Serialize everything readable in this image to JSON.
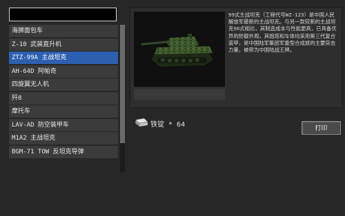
{
  "search": {
    "value": ""
  },
  "items": [
    {
      "label": "海狮面包车"
    },
    {
      "label": "Z-10 武装直升机"
    },
    {
      "label": "ZTZ-99A 主战坦克"
    },
    {
      "label": "AH-64D 阿帕奇"
    },
    {
      "label": "四旋翼无人机"
    },
    {
      "label": "歼8"
    },
    {
      "label": "摩托车"
    },
    {
      "label": "LAV-AD 防空装甲车"
    },
    {
      "label": "M1A2 主战坦克"
    },
    {
      "label": "BGM-71 TOW 反坦克导弹"
    }
  ],
  "selected_index": 2,
  "detail": {
    "description": "99式主战坦克（工程代号WZ-123）是中国人民解放军最新的主战坦克。与另一款较新的主战坦克96式相比，其制造成本与性能更高，已具备优异的防御外观，其炮塔和车体均采用第三代复合装甲，是中国陆军集团军重型合成旅的主要突击力量，被称为中国陆战王牌。",
    "cost_label": "铁锭 * 64",
    "print_label": "打印"
  },
  "colors": {
    "background": "#272727",
    "selected": "#2d5fb0",
    "item": "#3b3b3b"
  }
}
